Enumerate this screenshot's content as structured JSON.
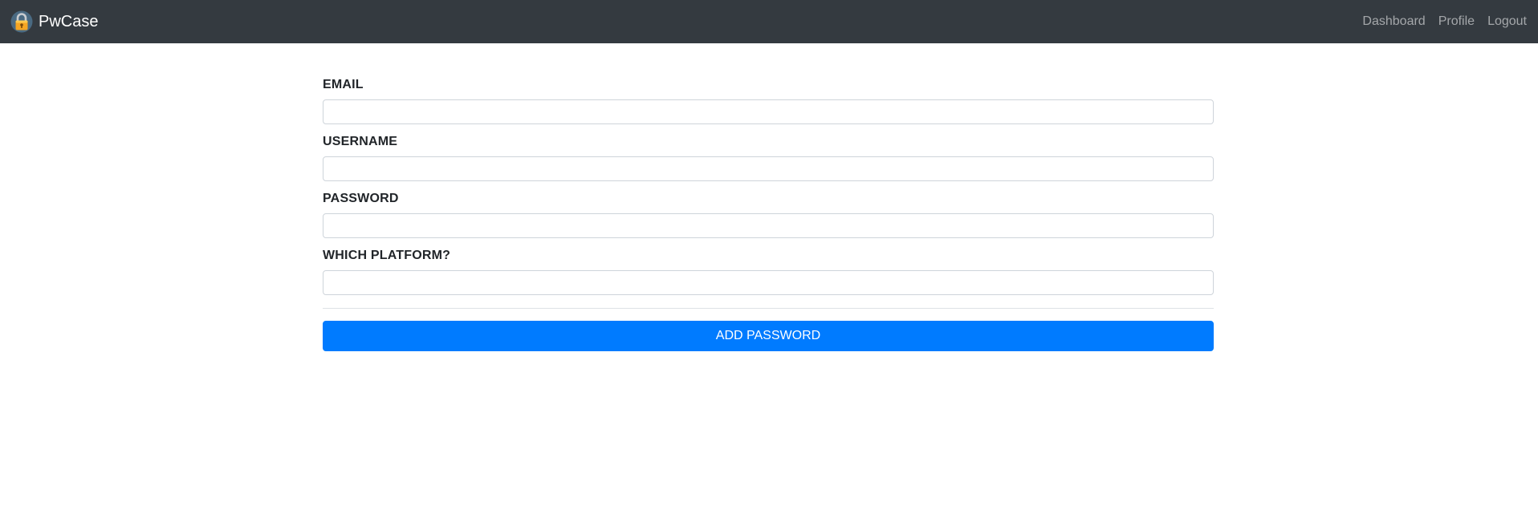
{
  "navbar": {
    "brand": "PwCase",
    "brand_icon": "padlock-icon",
    "links": {
      "dashboard": "Dashboard",
      "profile": "Profile",
      "logout": "Logout"
    }
  },
  "form": {
    "email": {
      "label": "EMAIL",
      "value": "",
      "placeholder": ""
    },
    "username": {
      "label": "USERNAME",
      "value": "",
      "placeholder": ""
    },
    "password": {
      "label": "PASSWORD",
      "value": "",
      "placeholder": ""
    },
    "platform": {
      "label": "WHICH PLATFORM?",
      "value": "",
      "placeholder": ""
    },
    "submit_label": "ADD PASSWORD"
  },
  "colors": {
    "navbar_bg": "#343a40",
    "primary": "#007bff",
    "lock_body": "#f5a623",
    "logo_circle": "#4a6a82"
  }
}
